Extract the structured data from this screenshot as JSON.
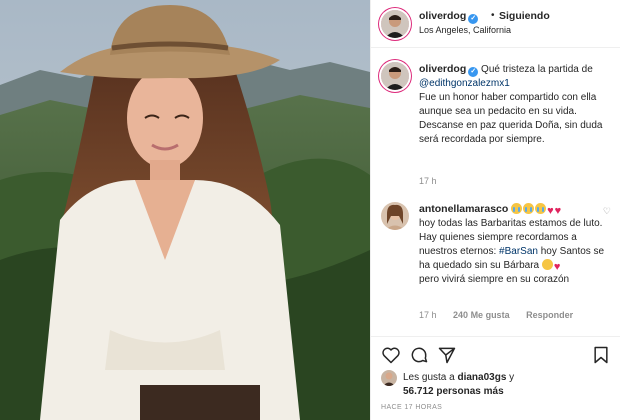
{
  "post": {
    "image_alt": "Woman wearing a straw cowboy hat and white shirt in front of green mountains"
  },
  "header": {
    "username": "oliverdog",
    "verified_mark": "✓",
    "separator": "•",
    "follow_label": "Siguiendo",
    "location": "Los Angeles, California"
  },
  "caption": {
    "username": "oliverdog",
    "verified_mark": "✓",
    "text_intro": " Qué tristeza la partida de",
    "mention": "@edithgonzalezmx1",
    "text_body": "Fue un honor haber compartido con ella aunque sea un pedacito en su vida.",
    "text_end": "Descanse en paz querida Doña, sin duda será recordada por siempre.",
    "time": "17 h"
  },
  "comment": {
    "username": "antonellamarasco",
    "text_1": "hoy todas las Barbaritas estamos de luto. Hay quienes siempre recordamos a nuestros eternos:",
    "hashtag": "#BarSan",
    "text_2": " hoy Santos se ha quedado sin su Bárbara",
    "text_3": "pero vivirá siempre en su corazón",
    "time": "17 h",
    "likes": "240 Me gusta",
    "reply_label": "Responder",
    "heart_glyph": "♡",
    "heart_emoji": "♥"
  },
  "likes": {
    "line1_prefix": "Les gusta a ",
    "line1_user": "diana03gs",
    "line1_suffix": " y",
    "line2_count": "56.712",
    "line2_suffix": " personas más"
  },
  "timestamp": "HACE 17 HORAS",
  "icons": {
    "like": "heart-outline-icon",
    "comment": "comment-bubble-icon",
    "share": "paper-plane-icon",
    "save": "bookmark-icon"
  },
  "colors": {
    "link": "#003569",
    "verified": "#3897f0",
    "muted": "#8e8e8e",
    "heart_red": "#e0245e"
  }
}
